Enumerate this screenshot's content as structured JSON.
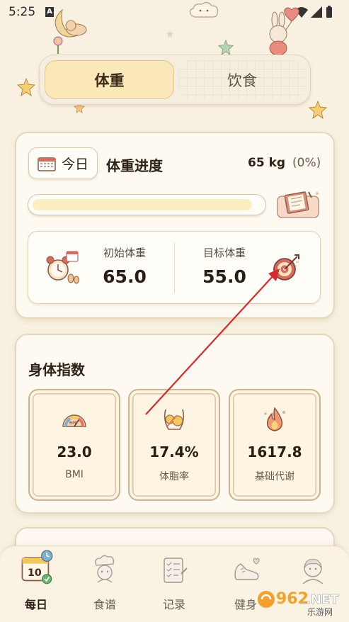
{
  "status_bar": {
    "time": "5:25"
  },
  "tabs": [
    {
      "label": "体重",
      "active": true
    },
    {
      "label": "饮食",
      "active": false
    }
  ],
  "weight_card": {
    "today_label": "今日",
    "title": "体重进度",
    "current_weight": "65 kg",
    "progress_percent": "(0%)",
    "progress_fraction": 0.96,
    "start_label": "初始体重",
    "start_value": "65.0",
    "target_label": "目标体重",
    "target_value": "55.0"
  },
  "index_card": {
    "title": "身体指数",
    "metrics": [
      {
        "value": "23.0",
        "label": "BMI",
        "icon": "bmi-gauge-icon"
      },
      {
        "value": "17.4%",
        "label": "体脂率",
        "icon": "body-fat-icon"
      },
      {
        "value": "1617.8",
        "label": "基础代谢",
        "icon": "metabolism-flame-icon"
      }
    ]
  },
  "bottom_nav": [
    {
      "label": "每日",
      "icon": "calendar-icon",
      "active": true
    },
    {
      "label": "食谱",
      "icon": "chef-icon",
      "active": false
    },
    {
      "label": "记录",
      "icon": "notebook-icon",
      "active": false
    },
    {
      "label": "健身",
      "icon": "sneaker-icon",
      "active": false
    },
    {
      "label": "",
      "icon": "profile-avatar-icon",
      "active": false
    }
  ],
  "watermark": {
    "text": "962.NET",
    "sub": "乐游网"
  },
  "colors": {
    "background": "#f8f1e2",
    "active_tab": "#fbe8b8",
    "card": "#fffaf1",
    "arrow": "#d42a2a"
  }
}
